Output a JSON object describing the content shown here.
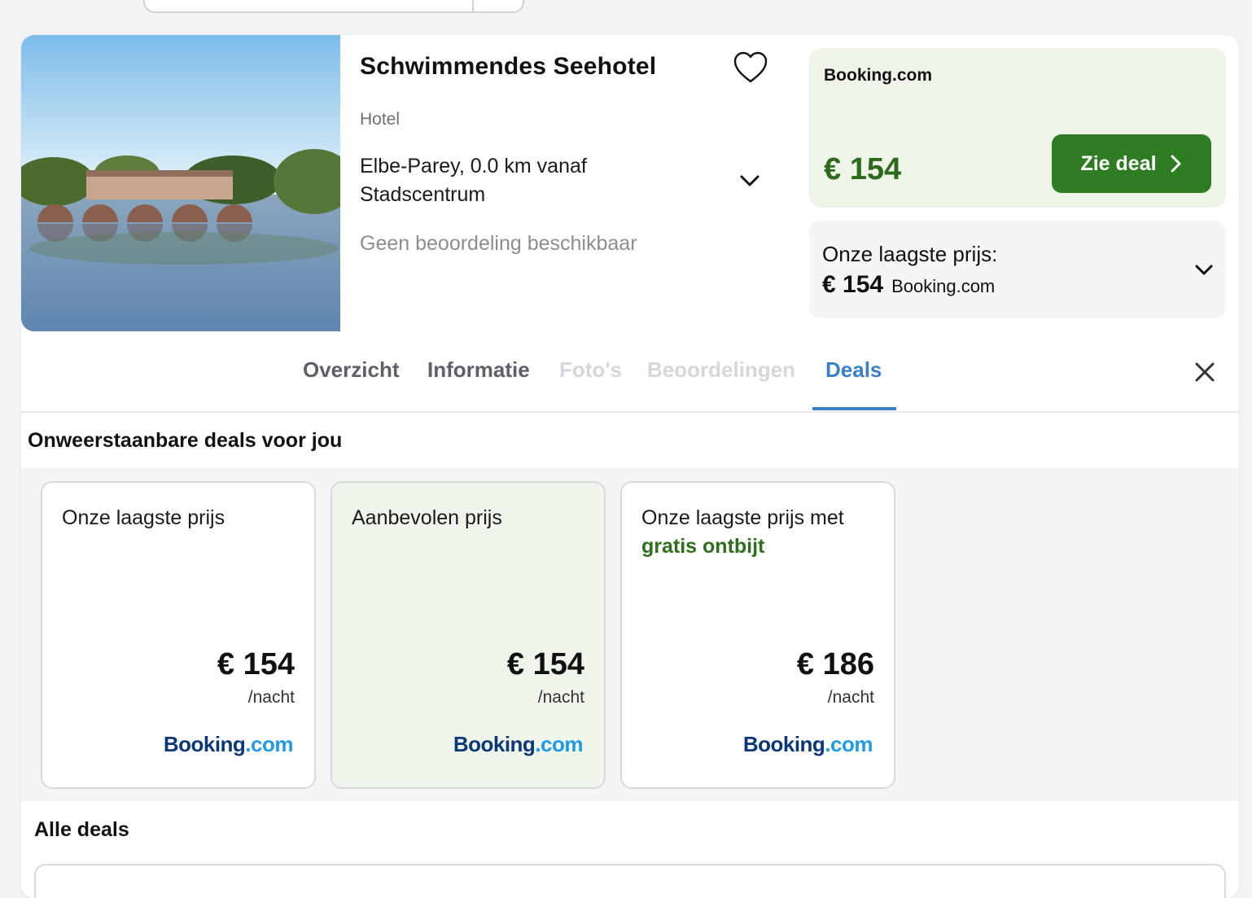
{
  "hotel": {
    "name": "Schwimmendes Seehotel",
    "type": "Hotel",
    "location": "Elbe-Parey, 0.0 km vanaf Stadscentrum",
    "rating": "Geen beoordeling beschikbaar"
  },
  "price_box": {
    "provider": "Booking.com",
    "price": "€ 154",
    "button_label": "Zie deal"
  },
  "lowest": {
    "label": "Onze laagste prijs:",
    "price": "€ 154",
    "provider": "Booking.com"
  },
  "tabs": [
    {
      "label": "Overzicht"
    },
    {
      "label": "Informatie"
    },
    {
      "label": "Foto's"
    },
    {
      "label": "Beoordelingen"
    },
    {
      "label": "Deals"
    }
  ],
  "section_title": "Onweerstaanbare deals voor jou",
  "deals": [
    {
      "title": "Onze laagste prijs",
      "highlight": "",
      "price": "€ 154",
      "unit": "/nacht",
      "logo_a": "Booking",
      "logo_b": ".com"
    },
    {
      "title": "Aanbevolen prijs",
      "highlight": "",
      "price": "€ 154",
      "unit": "/nacht",
      "logo_a": "Booking",
      "logo_b": ".com"
    },
    {
      "title": "Onze laagste prijs met",
      "highlight": "gratis ontbijt",
      "price": "€ 186",
      "unit": "/nacht",
      "logo_a": "Booking",
      "logo_b": ".com"
    }
  ],
  "all_deals_title": "Alle deals",
  "colors": {
    "accent_green": "#2f7d22",
    "price_green": "#2d6a1e",
    "tab_active": "#3b7fc4",
    "booking_blue": "#0c3878",
    "booking_light": "#1f9be5"
  },
  "icons": [
    "heart-icon",
    "chevron-down-icon",
    "chevron-right-icon",
    "close-icon"
  ]
}
